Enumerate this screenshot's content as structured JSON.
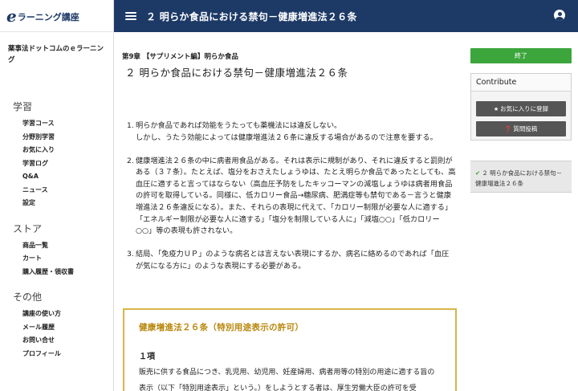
{
  "app": {
    "logo_e": "e",
    "logo_text": "ラーニング講座",
    "site_name": "薬事法ドットコムのｅラーニング"
  },
  "sidebar": {
    "sections": [
      {
        "heading": "学習",
        "items": [
          "学習コース",
          "分野別学習",
          "お気に入り",
          "学習ログ",
          "Q&A",
          "ニュース",
          "設定"
        ]
      },
      {
        "heading": "ストア",
        "items": [
          "商品一覧",
          "カート",
          "購入履歴・領収書"
        ]
      },
      {
        "heading": "その他",
        "items": [
          "講座の使い方",
          "メール履歴",
          "お問い合せ",
          "プロフィール"
        ]
      }
    ]
  },
  "header": {
    "title": "２ 明らか食品における禁句－健康増進法２６条",
    "menu_icon": "hamburger-menu-icon",
    "user_icon": "user-circle-icon"
  },
  "main": {
    "chapter": "第9章 【サプリメント編】明らか食品",
    "title": "２ 明らか食品における禁句－健康増進法２６条",
    "items": [
      {
        "num": "1.",
        "lines": [
          "明らか食品であれば効能をうたっても薬機法には違反しない。",
          "しかし、うたう効能によっては健康増進法２６条に違反する場合があるので注意を要する。"
        ]
      },
      {
        "num": "2.",
        "lines": [
          "健康増進法２６条の中に病者用食品がある。それは表示に規制があり、それに違反すると罰則がある（３７条）。たとえば、塩分をおさえたしょうゆは、たとえ明らか食品であったとしても、高血圧に適すると言ってはならない（高血圧予防をしたキッコーマンの減塩しょうゆは病者用食品の許可を取得している。同様に、低カロリー食品→糖尿病、肥満症等も禁句である－言うと健康増進法２６条違反になる）。また、それらの表現に代えて、「カロリー制限が必要な人に適する」「エネルギー制限が必要な人に適する」「塩分を制限している人に」「減塩○○」「低カロリー○○」等の表現も許されない。"
        ]
      },
      {
        "num": "3.",
        "lines": [
          "結局、「免疫力ＵＰ」のような病名とは言えない表現にするか、病名に絡めるのであれば「血圧が気になる方に」のような表現にする必要がある。"
        ]
      }
    ],
    "law_box": {
      "title": "健康増進法２６条（特別用途表示の許可）",
      "section": "１項",
      "body": "販売に供する食品につき、乳児用、幼児用、妊産婦用、病者用等の特別の用途に適する旨の表示（以下「特別用途表示」という。）をしようとする者は、厚生労働大臣の許可を受"
    }
  },
  "right": {
    "end_label": "終了",
    "contribute_heading": "Contribute",
    "favorite_label": "お気に入りに登録",
    "question_label": "質問投稿",
    "toc_item": "２ 明らか食品における禁句－健康増進法２６条"
  },
  "colors": {
    "header_bg": "#1d3a66",
    "end_button": "#3ca63c",
    "law_border": "#d9b44a",
    "law_title": "#b8860b"
  }
}
